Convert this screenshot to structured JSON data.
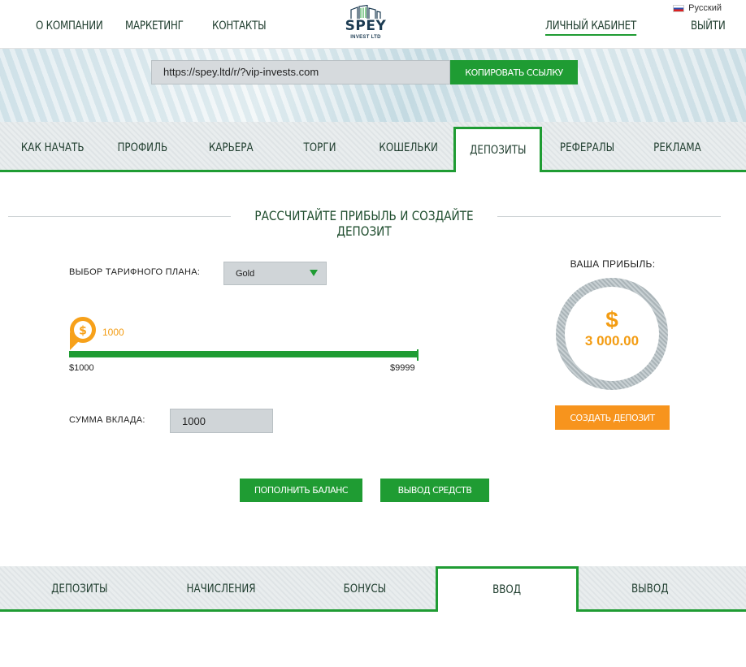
{
  "header": {
    "nav": [
      "О КОМПАНИИ",
      "МАРКЕТИНГ",
      "КОНТАКТЫ"
    ],
    "logo_name": "SPEY",
    "logo_sub": "INVEST LTD",
    "account": "ЛИЧНЫЙ КАБИНЕТ",
    "logout": "ВЫЙТИ",
    "language": "Русский"
  },
  "referral": {
    "link": "https://spey.ltd/r/?vip-invests.com",
    "copy_label": "КОПИРОВАТЬ ССЫЛКУ"
  },
  "tabs": [
    "КАК НАЧАТЬ",
    "ПРОФИЛЬ",
    "КАРЬЕРА",
    "ТОРГИ",
    "КОШЕЛЬКИ",
    "ДЕПОЗИТЫ",
    "РЕФЕРАЛЫ",
    "РЕКЛАМА"
  ],
  "active_tab": "ДЕПОЗИТЫ",
  "calculator": {
    "title": "РАССЧИТАЙТЕ ПРИБЫЛЬ И СОЗДАЙТЕ ДЕПОЗИТ",
    "plan_label": "ВЫБОР ТАРИФНОГО ПЛАНА:",
    "plan_value": "Gold",
    "slider_value": "1000",
    "slider_min": "$1000",
    "slider_max": "$9999",
    "amount_label": "СУММА ВКЛАДА:",
    "amount_value": "1000",
    "profit_label": "ВАША ПРИБЫЛЬ:",
    "profit_currency": "$",
    "profit_value": "3 000.00",
    "create_label": "СОЗДАТЬ ДЕПОЗИТ"
  },
  "actions": {
    "topup_label": "ПОПОЛНИТЬ БАЛАНС",
    "withdraw_label": "ВЫВОД СРЕДСТВ"
  },
  "subtabs": [
    "ДЕПОЗИТЫ",
    "НАЧИСЛЕНИЯ",
    "БОНУСЫ",
    "ВВОД",
    "ВЫВОД"
  ],
  "active_subtab": "ВВОД",
  "colors": {
    "accent": "#1f9c33",
    "orange": "#f7941d",
    "profit": "#f39c12"
  }
}
